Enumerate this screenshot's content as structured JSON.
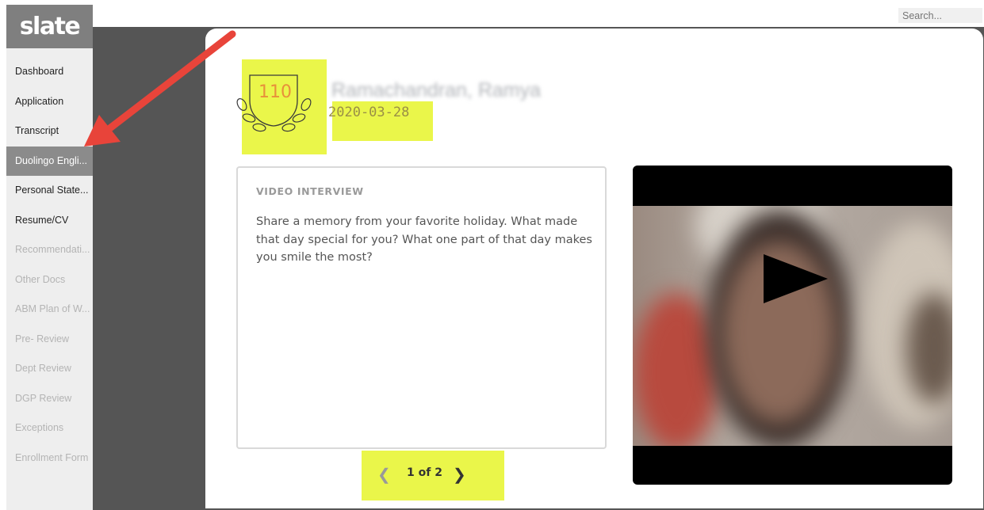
{
  "app": {
    "logo": "slate"
  },
  "search": {
    "placeholder": "Search..."
  },
  "sidebar": {
    "items": [
      {
        "label": "Dashboard"
      },
      {
        "label": "Application"
      },
      {
        "label": "Transcript"
      },
      {
        "label": "Duolingo Engli..."
      },
      {
        "label": "Personal State..."
      },
      {
        "label": "Resume/CV"
      },
      {
        "label": "Recommendati..."
      },
      {
        "label": "Other Docs"
      },
      {
        "label": "ABM Plan of W..."
      },
      {
        "label": "Pre- Review"
      },
      {
        "label": "Dept Review"
      },
      {
        "label": "DGP Review"
      },
      {
        "label": "Exceptions"
      },
      {
        "label": "Enrollment Form"
      }
    ],
    "active_index": 3
  },
  "header": {
    "score": "110",
    "name": "Ramachandran, Ramya",
    "date": "2020-03-28"
  },
  "interview": {
    "title": "VIDEO INTERVIEW",
    "question": "Share a memory from your favorite holiday. What made that day special for you? What one part of that day makes you smile the most?"
  },
  "pager": {
    "prev_icon": "chevron-left-icon",
    "label": "1 of 2",
    "next_icon": "chevron-right-icon"
  },
  "video": {
    "icon": "play-icon"
  },
  "colors": {
    "highlight": "#eaf64a",
    "score": "#e8903a",
    "arrow": "#e8443a",
    "active_nav": "#8b8b8b"
  }
}
